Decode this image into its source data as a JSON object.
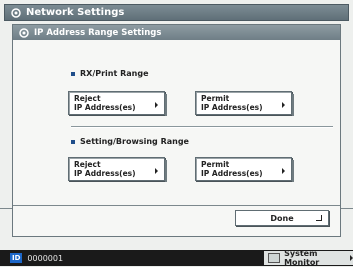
{
  "window": {
    "title": "Network Settings",
    "icon": "gear-icon"
  },
  "dialog": {
    "title": "IP Address Range Settings",
    "icon": "gear-icon"
  },
  "sections": [
    {
      "label": "RX/Print Range",
      "reject_label_l1": "Reject",
      "reject_label_l2": "IP Address(es)",
      "permit_label_l1": "Permit",
      "permit_label_l2": "IP Address(es)"
    },
    {
      "label": "Setting/Browsing Range",
      "reject_label_l1": "Reject",
      "reject_label_l2": "IP Address(es)",
      "permit_label_l1": "Permit",
      "permit_label_l2": "IP Address(es)"
    }
  ],
  "done_label": "Done",
  "status": {
    "id_badge": "ID",
    "id_value": "0000001",
    "system_monitor": "System Monitor"
  },
  "colors": {
    "accent": "#1c67c9",
    "titlebar": "#6f7e86"
  }
}
